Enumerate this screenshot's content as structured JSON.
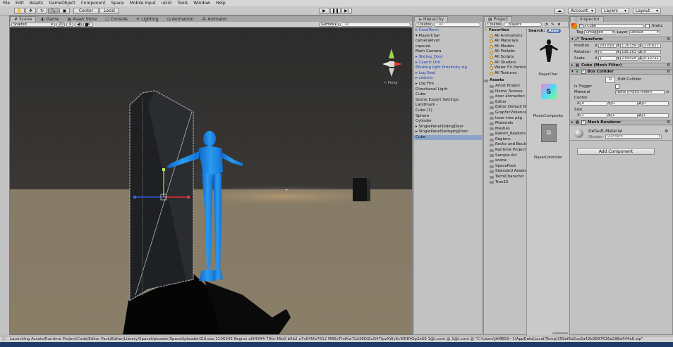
{
  "menu": [
    "File",
    "Edit",
    "Assets",
    "GameObject",
    "Component",
    "Space",
    "Mobile Input",
    "uGUI",
    "Tools",
    "Window",
    "Help"
  ],
  "toolbar": {
    "pivot": "Center",
    "space": "Local",
    "account": "Account",
    "layers": "Layers",
    "layout": "Layout"
  },
  "scene": {
    "tabs": [
      "Scene",
      "Game",
      "Asset Store",
      "Console",
      "Lighting",
      "Animation",
      "Animator"
    ],
    "shading": "Shaded",
    "mode2d": "2D",
    "gizmos": "Gizmos",
    "search_placeholder": "All",
    "persp": "< Persp"
  },
  "hierarchy": {
    "title": "Hierarchy",
    "create": "Create",
    "search_placeholder": "All",
    "items": [
      {
        "label": "▸ CaveTorch",
        "style": "blue"
      },
      {
        "label": "▾ PlayerChar",
        "style": ""
      },
      {
        "label": "      cameraPivot",
        "style": ""
      },
      {
        "label": "      capsule",
        "style": ""
      },
      {
        "label": "      Main Camera",
        "style": ""
      },
      {
        "label": "▸ Sliding_Door",
        "style": "blue"
      },
      {
        "label": "▸ Cyanic Orb",
        "style": "blue"
      },
      {
        "label": "   Blinking light Proximity sig",
        "style": "blue"
      },
      {
        "label": "▸ Log Seat",
        "style": "blue"
      },
      {
        "label": "▸ cestmo",
        "style": "blue"
      },
      {
        "label": "▸ Log Fire",
        "style": ""
      },
      {
        "label": "   Directional Light",
        "style": ""
      },
      {
        "label": "   Cube",
        "style": ""
      },
      {
        "label": "   Scene Export Settings",
        "style": ""
      },
      {
        "label": "   Landmark -",
        "style": ""
      },
      {
        "label": "   Cube (1)",
        "style": ""
      },
      {
        "label": "   Sphere",
        "style": ""
      },
      {
        "label": "   Cylinder",
        "style": ""
      },
      {
        "label": "▸ SinglePanelSlidingDoor",
        "style": ""
      },
      {
        "label": "▸ SinglePanelSwingingDoor",
        "style": ""
      },
      {
        "label": "   Cube",
        "style": "sel"
      }
    ]
  },
  "project": {
    "title": "Project",
    "create": "Create",
    "search_value": "players",
    "search_label": "Search:",
    "search_scope": "Asse",
    "favorites_label": "Favorites",
    "favorites": [
      "All Animations",
      "All Materials",
      "All Models",
      "All Prefabs",
      "All Scripts",
      "All Shaders",
      "Water FX Particles",
      "All Textures"
    ],
    "assets_label": "Assets",
    "assets": [
      "Artist Project",
      "Demo_Scenes",
      "door animation",
      "Editor",
      "Editor Default Resources",
      "GraphicViolence",
      "laser tree pkg",
      "Materials",
      "Meshes",
      "Rakshi_Realistic",
      "Regions",
      "Rocks and Boulders",
      "Runtime Project",
      "Sample Art",
      "scene",
      "SpacePack",
      "Standard Assets",
      "TachiCharacter",
      "Tree10"
    ],
    "results": [
      "PlayerChar",
      "PlayerComposite",
      "PlayerController"
    ]
  },
  "inspector": {
    "title": "Inspector",
    "object_name": "Cube",
    "static_label": "Static",
    "tag_label": "Tag",
    "tag_value": "Untagged",
    "layer_label": "Layer",
    "layer_value": "Default",
    "transform": {
      "title": "Transform",
      "position_label": "Position",
      "rotation_label": "Rotation",
      "scale_label": "Scale",
      "position": [
        "283.816",
        "1.20159",
        "278.627"
      ],
      "rotation": [
        "0",
        "108.261",
        "0"
      ],
      "scale": [
        "1",
        "2.09424",
        "0.12721"
      ]
    },
    "mesh_filter": {
      "title": "Cube (Mesh Filter)"
    },
    "box_collider": {
      "title": "Box Collider",
      "edit_label": "Edit Collider",
      "is_trigger_label": "Is Trigger",
      "material_label": "Material",
      "material_value": "None (Physic Materi",
      "center_label": "Center",
      "center": [
        "0",
        "0",
        "0"
      ],
      "size_label": "Size",
      "size": [
        "1",
        "1",
        "1"
      ]
    },
    "mesh_renderer": {
      "title": "Mesh Renderer"
    },
    "material": {
      "name": "Default-Material",
      "shader_label": "Shader",
      "shader_value": "Standard"
    },
    "add_component": "Add Component",
    "axis": [
      "X",
      "Y",
      "Z"
    ]
  },
  "status": {
    "text": "Launching Assets/Runtime Project/Code/Editor Pack/Editor/Library/SpaceUploader/SpaceUploaderGUI.exe 2106343 Region af943ff4-79fa-45b0-b0b2-a7c645fb7612 M86vThdXw7Lb38DiZuO47fpzXWy6cWR8YOp2eS9 1@t.com @ 1@t.com @ \"C:\\Users\\JAMESS~1\\AppData\\Local\\Temp\\359af6d2ce2a42b3997616a298d444e8.zip\""
  },
  "colors": {
    "character": "#1e88e5",
    "sky": "#2e2e2e",
    "ground": "#847a67",
    "selected_row": "#8aa3c9",
    "blue_prefab": "#1a3fb8"
  }
}
